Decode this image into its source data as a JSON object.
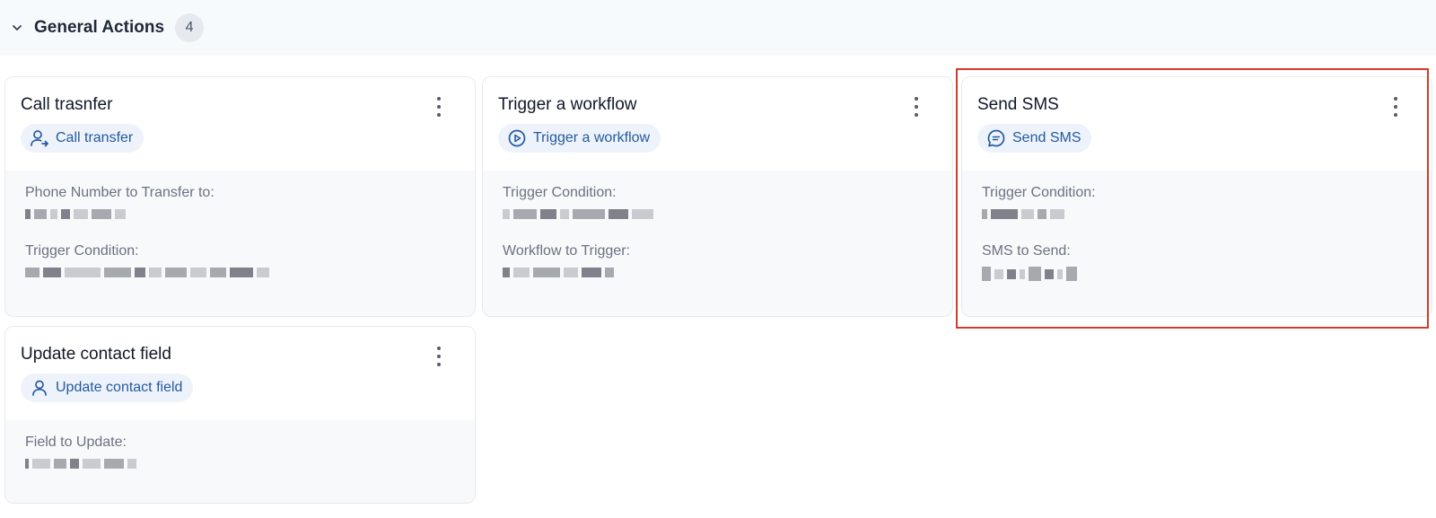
{
  "section": {
    "title": "General Actions",
    "count": "4"
  },
  "cards": [
    {
      "title": "Call trasnfer",
      "pill": "Call transfer",
      "fields": [
        {
          "label": "Phone Number to Transfer to:"
        },
        {
          "label": "Trigger Condition:"
        }
      ]
    },
    {
      "title": "Trigger a workflow",
      "pill": "Trigger a workflow",
      "fields": [
        {
          "label": "Trigger Condition:"
        },
        {
          "label": "Workflow to Trigger:"
        }
      ]
    },
    {
      "title": "Send SMS",
      "pill": "Send SMS",
      "fields": [
        {
          "label": "Trigger Condition:"
        },
        {
          "label": "SMS to Send:"
        }
      ]
    },
    {
      "title": "Update contact field",
      "pill": "Update contact field",
      "fields": [
        {
          "label": "Field to Update:"
        }
      ]
    }
  ],
  "colors": {
    "accent": "#245a9f",
    "pill_bg": "#eef3fb",
    "highlight": "#d63a2b"
  }
}
